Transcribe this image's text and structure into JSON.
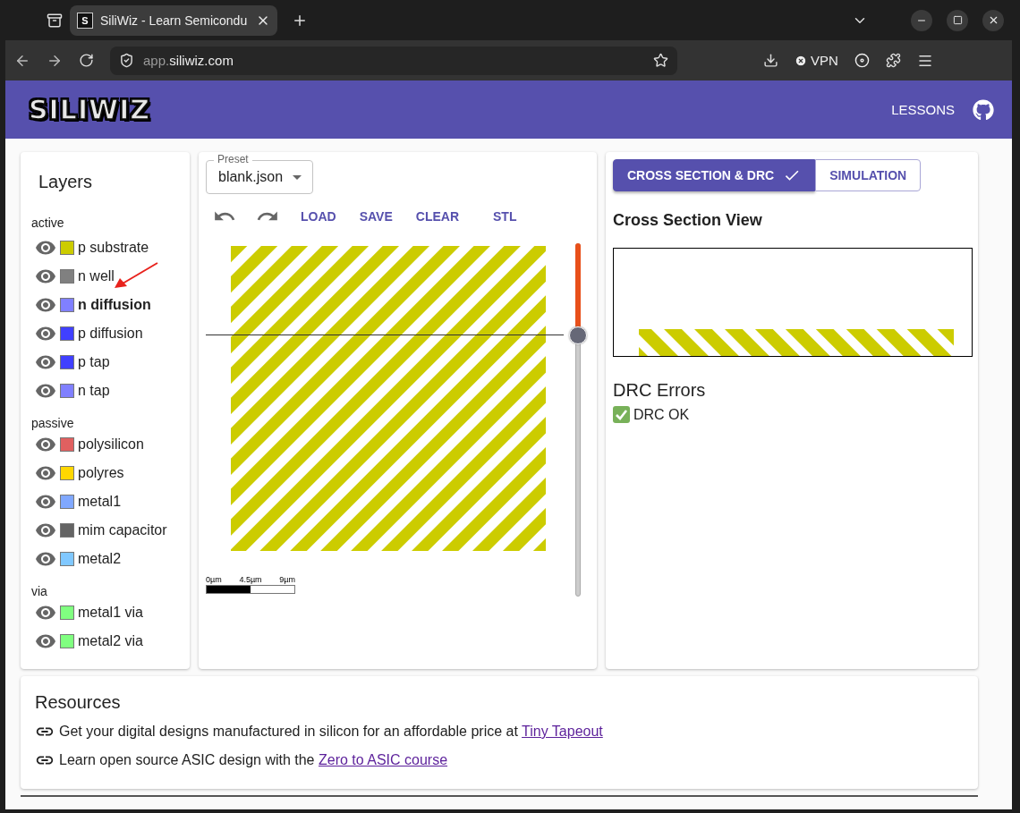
{
  "browser": {
    "tab_title": "SiliWiz - Learn Semicondu",
    "favicon": "S",
    "url_prefix": "app.",
    "url_domain": "siliwiz.com",
    "vpn": "VPN"
  },
  "header": {
    "logo": "SILIWIZ",
    "nav": "LESSONS"
  },
  "layers": {
    "title": "Layers",
    "groups": [
      {
        "name": "active",
        "items": [
          {
            "name": "p substrate",
            "color": "#cccc00",
            "visible": true,
            "selected": false
          },
          {
            "name": "n well",
            "color": "#808080",
            "visible": true,
            "selected": false
          },
          {
            "name": "n diffusion",
            "color": "#8080ff",
            "visible": true,
            "selected": true
          },
          {
            "name": "p diffusion",
            "color": "#4040ff",
            "visible": true,
            "selected": false
          },
          {
            "name": "p tap",
            "color": "#4040ff",
            "visible": true,
            "selected": false
          },
          {
            "name": "n tap",
            "color": "#8080ff",
            "visible": true,
            "selected": false
          }
        ]
      },
      {
        "name": "passive",
        "items": [
          {
            "name": "polysilicon",
            "color": "#e06060",
            "visible": true,
            "selected": false
          },
          {
            "name": "polyres",
            "color": "#ffd700",
            "visible": true,
            "selected": false
          },
          {
            "name": "metal1",
            "color": "#80a8ff",
            "visible": true,
            "selected": false
          },
          {
            "name": "mim capacitor",
            "color": "#646464",
            "visible": true,
            "selected": false
          },
          {
            "name": "metal2",
            "color": "#80c8ff",
            "visible": true,
            "selected": false
          }
        ]
      },
      {
        "name": "via",
        "items": [
          {
            "name": "metal1 via",
            "color": "#80ff80",
            "visible": true,
            "selected": false
          },
          {
            "name": "metal2 via",
            "color": "#80ff80",
            "visible": true,
            "selected": false
          }
        ]
      }
    ]
  },
  "editor": {
    "preset": {
      "label": "Preset",
      "value": "blank.json"
    },
    "actions": [
      "LOAD",
      "SAVE",
      "CLEAR",
      "STL"
    ],
    "scale": [
      "0µm",
      "4.5µm",
      "9µm"
    ],
    "slider": {
      "level": 0.74
    }
  },
  "right": {
    "tabs": [
      {
        "label": "CROSS SECTION & DRC",
        "selected": true
      },
      {
        "label": "SIMULATION",
        "selected": false
      }
    ],
    "cross_section_title": "Cross Section View",
    "drc_title": "DRC Errors",
    "drc_message": "DRC OK"
  },
  "resources": {
    "title": "Resources",
    "items": [
      {
        "text": "Get your digital designs manufactured in silicon for an affordable price at ",
        "link": "Tiny Tapeout"
      },
      {
        "text": "Learn open source ASIC design with the ",
        "link": "Zero to ASIC course"
      }
    ]
  }
}
